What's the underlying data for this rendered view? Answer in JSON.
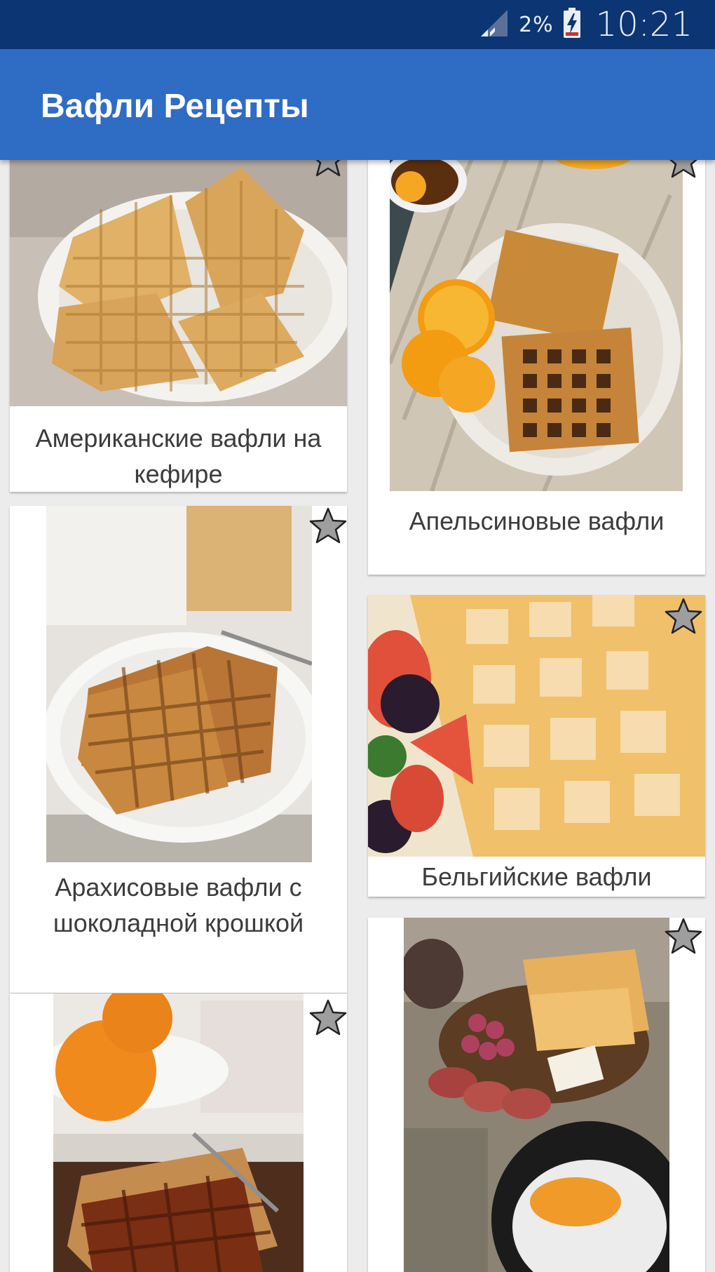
{
  "status_bar": {
    "icons": [
      "signal-icon",
      "battery-charging-icon"
    ],
    "battery_percent": "2%",
    "time": "10:21"
  },
  "app_bar": {
    "title": "Вафли Рецепты",
    "color": "#2f6cc4"
  },
  "recipes": [
    {
      "title": "Американские вафли на кефире",
      "favorite_icon": "star-outline-icon"
    },
    {
      "title": "Апельсиновые вафли",
      "favorite_icon": "star-outline-icon"
    },
    {
      "title": "Арахисовые вафли с шоколадной крошкой",
      "favorite_icon": "star-outline-icon"
    },
    {
      "title": "Бельгийские вафли",
      "favorite_icon": "star-outline-icon"
    },
    {
      "title": "",
      "favorite_icon": "star-outline-icon"
    },
    {
      "title": "",
      "favorite_icon": "star-outline-icon"
    }
  ],
  "colors": {
    "status_bar": "#0c3573",
    "background": "#ececec",
    "star_fill": "#9e9e9e"
  }
}
